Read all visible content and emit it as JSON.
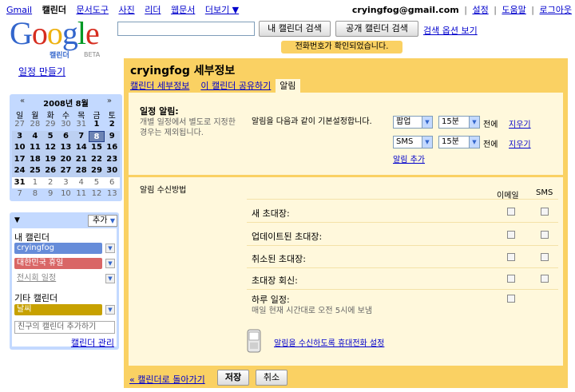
{
  "topnav": {
    "left": [
      "Gmail",
      "캘린더",
      "문서도구",
      "사진",
      "리더",
      "웹문서",
      "더보기 ▼"
    ],
    "current_index": 1,
    "email": "cryingfog@gmail.com",
    "right_links": [
      "설정",
      "도움말",
      "로그아웃"
    ]
  },
  "logo": {
    "word": "Google",
    "sub": "캘린더",
    "beta": "BETA"
  },
  "search": {
    "value": "",
    "cal_button": "내 캘린더 검색",
    "pub_button": "공개 캘린더 검색",
    "options": "검색 옵션 보기"
  },
  "notice": "전화번호가 확인되었습니다.",
  "sidebar": {
    "create": "일정 만들기",
    "minical": {
      "prev": "«",
      "next": "»",
      "title": "2008년 8월",
      "dows": [
        "일",
        "월",
        "화",
        "수",
        "목",
        "금",
        "토"
      ],
      "weeks": [
        [
          "27",
          "28",
          "29",
          "30",
          "31",
          "1",
          "2"
        ],
        [
          "3",
          "4",
          "5",
          "6",
          "7",
          "8",
          "9"
        ],
        [
          "10",
          "11",
          "12",
          "13",
          "14",
          "15",
          "16"
        ],
        [
          "17",
          "18",
          "19",
          "20",
          "21",
          "22",
          "23"
        ],
        [
          "24",
          "25",
          "26",
          "27",
          "28",
          "29",
          "30"
        ],
        [
          "31",
          "1",
          "2",
          "3",
          "4",
          "5",
          "6"
        ],
        [
          "7",
          "8",
          "9",
          "10",
          "11",
          "12",
          "13"
        ]
      ]
    },
    "add_button": "추가",
    "my_cals_label": "내 캘린더",
    "my_cals": [
      {
        "name": "cryingfog",
        "color": "#668cd9"
      },
      {
        "name": "대한민국 휴일",
        "color": "#d96666"
      },
      {
        "name": "전시회 일정",
        "color": ""
      }
    ],
    "other_cals_label": "기타 캘린더",
    "other_cals": [
      {
        "name": "날씨",
        "color": "#c7a100"
      }
    ],
    "friend_placeholder": "친구의 캘린더 추가하기",
    "manage": "캘린더 관리"
  },
  "main": {
    "title": "cryingfog 세부정보",
    "tabs": [
      "캘린더 세부정보",
      "이 캘린더 공유하기",
      "알림"
    ],
    "event_alert": {
      "title": "일정 알림:",
      "desc": "개별 일정에서 별도로 지정한 경우는 제외됩니다.",
      "instruction": "알림을 다음과 같이 기본설정합니다.",
      "rows": [
        {
          "type": "팝업",
          "time": "15분",
          "suffix": "전에",
          "remove": "지우기"
        },
        {
          "type": "SMS",
          "time": "15분",
          "suffix": "전에",
          "remove": "지우기"
        }
      ],
      "add": "알림 추가"
    },
    "delivery": {
      "title": "알림 수신방법",
      "col_email": "이메일",
      "col_sms": "SMS",
      "rows": [
        "새 초대장:",
        "업데이트된 초대장:",
        "취소된 초대장:",
        "초대장 회신:",
        "하루 일정:"
      ],
      "daily_note": "매일 현재 시간대로 오전 5시에 보냄",
      "phone_link": "알림을 수신하도록 휴대전화 설정"
    }
  },
  "footer": {
    "back": "« 캘린더로 돌아가기",
    "save": "저장",
    "cancel": "취소"
  }
}
